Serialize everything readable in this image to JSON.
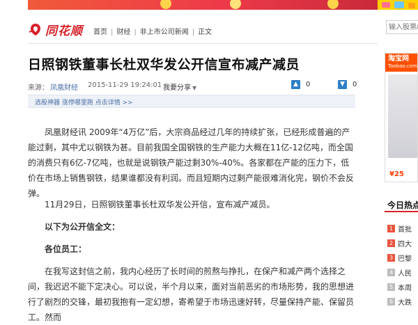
{
  "site": {
    "logo_text": "同花顺"
  },
  "breadcrumb": [
    "首页",
    "财经",
    "非上市公司新闻",
    "正文"
  ],
  "search": {
    "placeholder": "输入股票/"
  },
  "article": {
    "title": "日照钢铁董事长杜双华发公开信宣布减产减员",
    "source_label": "来源：",
    "source_name": "凤凰财经",
    "date": "2015-11-29 19:24:01",
    "share_label": "我要分享",
    "upvotes": "0",
    "downvotes": "0",
    "toolbar_text": "选股神器 涨停哪里跑 点击详情 >>",
    "paragraphs": [
      "凤凰财经讯 2009年“4万亿”后，大宗商品经过几年的持续扩张，已经形成普遍的产能过剩，其中尤以钢铁为甚。目前我国全国钢铁的生产能力大概在11亿-12亿吨，而全国的消费只有6亿-7亿吨，也就是说钢铁产能过剩30%-40%。各家都在产能的压力下，低价在市场上销售钢铁，结果谁都没有利润。而且短期内过剩产能很难消化完，钢价不会反弹。",
      "11月29日，日照钢铁董事长杜双华发公开信，宣布减产减员。",
      "以下为公开信全文：",
      "各位员工：",
      "在我写这封信之前，我内心经历了长时间的煎熬与挣扎，在保产和减产两个选择之间，我迟迟不能下定决心。可以说，半个月以来，面对当前恶劣的市场形势，我的思想进行了剧烈的交锋，最初我抱有一定幻想，寄希望于市场迅速好转，尽量保持产能、保留员工。然而"
    ]
  },
  "ad": {
    "brand": "淘宝网",
    "brand_sub": "Taobao.com",
    "price": "¥25"
  },
  "hot": {
    "title": "今日热点",
    "items": [
      {
        "num": "1",
        "text": "首批"
      },
      {
        "num": "2",
        "text": "四大"
      },
      {
        "num": "3",
        "text": "巴黎"
      },
      {
        "num": "4",
        "text": "人民"
      },
      {
        "num": "5",
        "text": "本周"
      },
      {
        "num": "6",
        "text": "大跌"
      }
    ]
  },
  "colors": {
    "brand_red": "#d7212a",
    "link_blue": "#4a6fa5",
    "vote_blue": "#2f7fc6",
    "taobao_orange": "#ff5000"
  }
}
